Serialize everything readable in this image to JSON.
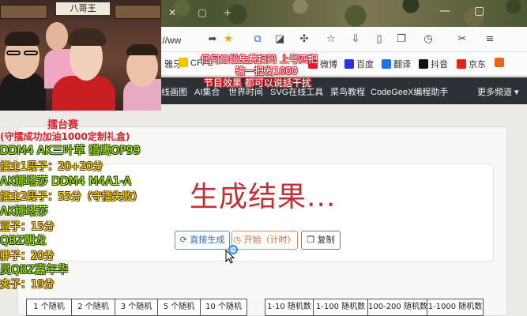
{
  "browser": {
    "url_fragment": "s://ww",
    "window_controls": {
      "minimize": "—",
      "maximize": "▢"
    },
    "tab_plus": "+",
    "bookmarks": [
      {
        "label": "雅牙",
        "color": "#ffffff"
      },
      {
        "label": "CFPL",
        "color": "#f4c400"
      },
      {
        "label": "微博",
        "color": "#e6162d"
      },
      {
        "label": "百度",
        "color": "#2932e1"
      },
      {
        "label": "翻译",
        "color": "#1a73e8"
      },
      {
        "label": "抖音",
        "color": "#111111"
      },
      {
        "label": "京东",
        "color": "#e1251b"
      }
    ],
    "toolbar_icons": [
      "share-icon",
      "star-icon",
      "extension-icon",
      "extension-icon",
      "puzzle-icon",
      "favorites-icon",
      "download-icon",
      "phone-icon",
      "tabs-icon",
      "history-icon",
      "scissors-icon",
      "menu-icon"
    ]
  },
  "site_nav": {
    "items": [
      "线画图",
      "AI集合",
      "世界时间",
      "SVG在线工具",
      "菜鸟教程",
      "CodeGeeX编程助手",
      "更多频道"
    ]
  },
  "main": {
    "result_text": "生成结果...",
    "buttons": {
      "direct": "直接生成",
      "start": "开始（计时）",
      "copy": "复制"
    },
    "grid_left": [
      "1 个随机",
      "2 个随机",
      "3 个随机",
      "5 个随机",
      "10 个随机"
    ],
    "grid_right": [
      "1-10 随机数",
      "1-100 随机数",
      "100-200 随机数",
      "1-1000 随机数"
    ]
  },
  "video_overlay": {
    "sign_text": "八哥王",
    "captions_top": [
      "任何分段免费扫码 上号四把",
      "输一把发1000",
      "节目效果 都可以说話干扰"
    ],
    "ring_title": "擂台赛",
    "ring_subtitle": "(守擂成功加油1000定制礼盒)",
    "lines": [
      {
        "text": "DDM4 AK三叶草 猎鹰OP99",
        "style": "green"
      },
      {
        "text": "擂主1段子：20+20分",
        "style": "yellow"
      },
      {
        "text": "AK娜塔莎 DDM4 M4A1-A",
        "style": "green"
      },
      {
        "text": "擂主2段子：55分（守擂失败）",
        "style": "yellow"
      },
      {
        "text": "AK娜塔莎",
        "style": "green"
      },
      {
        "text": "豆子：15分",
        "style": "yellow"
      },
      {
        "text": "QBZ朝龙",
        "style": "green"
      },
      {
        "text": "胖子：20分",
        "style": "yellow"
      },
      {
        "text": "灵QBZ嘉年华",
        "style": "green"
      },
      {
        "text": "夹子：19分",
        "style": "yellow"
      }
    ]
  },
  "colors": {
    "accent_red": "#c03238",
    "nav_bg": "#2c3138",
    "btn_blue": "#2f6db5",
    "btn_orange": "#d46a2f",
    "caption_green": "#b8f02a",
    "caption_yellow": "#ffe419"
  }
}
